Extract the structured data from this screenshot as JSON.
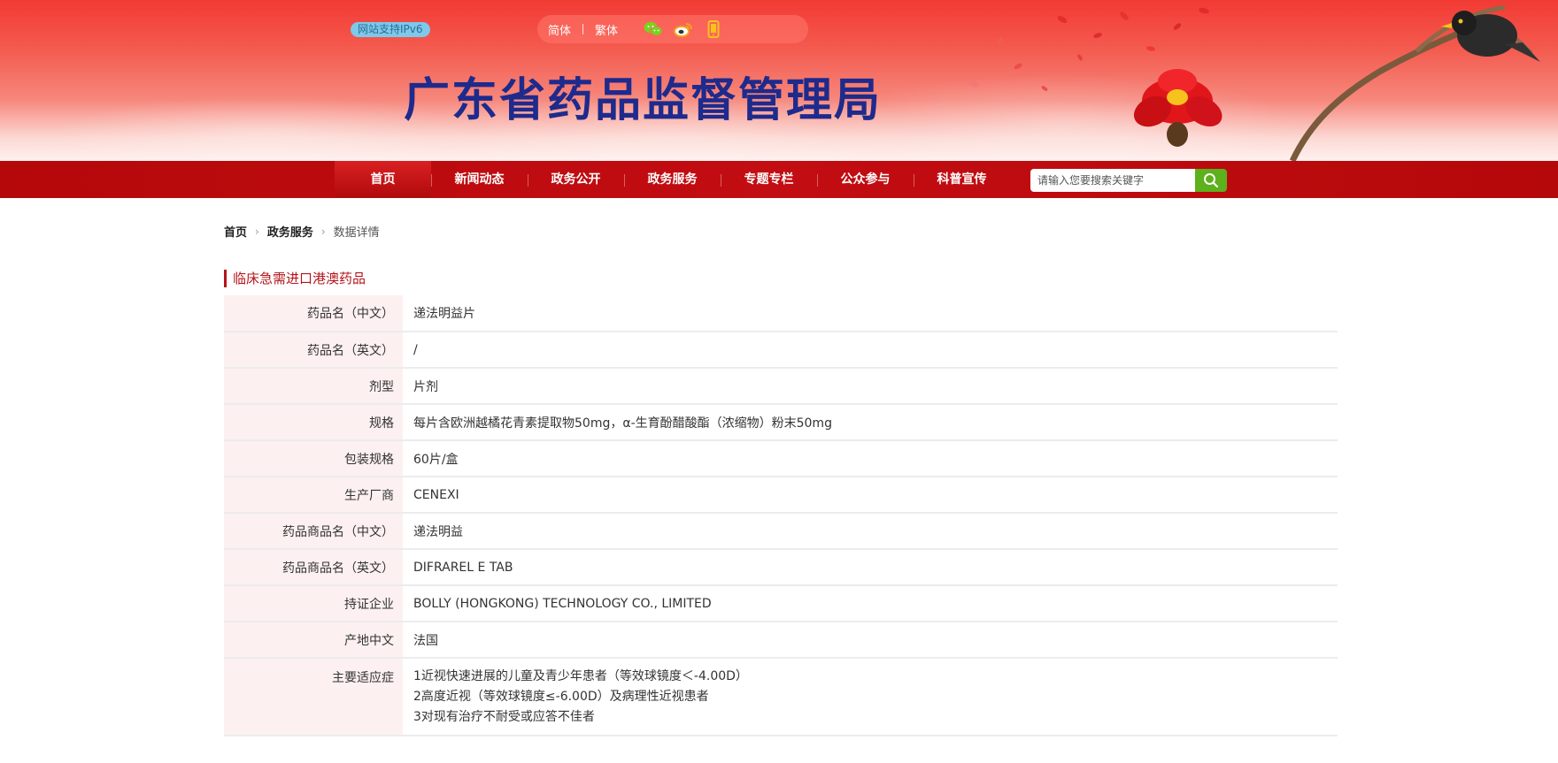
{
  "header": {
    "ipv6_badge": "网站支持IPv6",
    "lang_simplified": "简体",
    "lang_traditional": "繁体",
    "site_title": "广东省药品监督管理局"
  },
  "nav": {
    "items": [
      "首页",
      "新闻动态",
      "政务公开",
      "政务服务",
      "专题专栏",
      "公众参与",
      "科普宣传"
    ],
    "search_placeholder": "请输入您要搜索关键字"
  },
  "breadcrumb": {
    "home": "首页",
    "section": "政务服务",
    "current": "数据详情"
  },
  "section_title": "临床急需进口港澳药品",
  "details": [
    {
      "label": "药品名（中文）",
      "value": "递法明益片"
    },
    {
      "label": "药品名（英文）",
      "value": "/"
    },
    {
      "label": "剂型",
      "value": "片剂"
    },
    {
      "label": "规格",
      "value": "每片含欧洲越橘花青素提取物50mg，α-生育酚醋酸酯（浓缩物）粉末50mg"
    },
    {
      "label": "包装规格",
      "value": "60片/盒"
    },
    {
      "label": "生产厂商",
      "value": "CENEXI"
    },
    {
      "label": "药品商品名（中文）",
      "value": "递法明益"
    },
    {
      "label": "药品商品名（英文）",
      "value": "DIFRAREL E TAB"
    },
    {
      "label": "持证企业",
      "value": "BOLLY (HONGKONG) TECHNOLOGY CO., LIMITED"
    },
    {
      "label": "产地中文",
      "value": "法国"
    }
  ],
  "indications": {
    "label": "主要适应症",
    "lines": [
      "1近视快速进展的儿童及青少年患者（等效球镜度＜-4.00D）",
      "2高度近视（等效球镜度≤-6.00D）及病理性近视患者",
      "3对现有治疗不耐受或应答不佳者"
    ]
  },
  "colors": {
    "nav_bg": "#b5080a",
    "title_blue": "#1e2a8c",
    "accent_red": "#b3141a",
    "search_green": "#5db11c",
    "label_bg": "#fdf0f0"
  },
  "icons": [
    "wechat-icon",
    "weibo-icon",
    "mobile-icon",
    "search-icon",
    "chevron-right-icon"
  ]
}
